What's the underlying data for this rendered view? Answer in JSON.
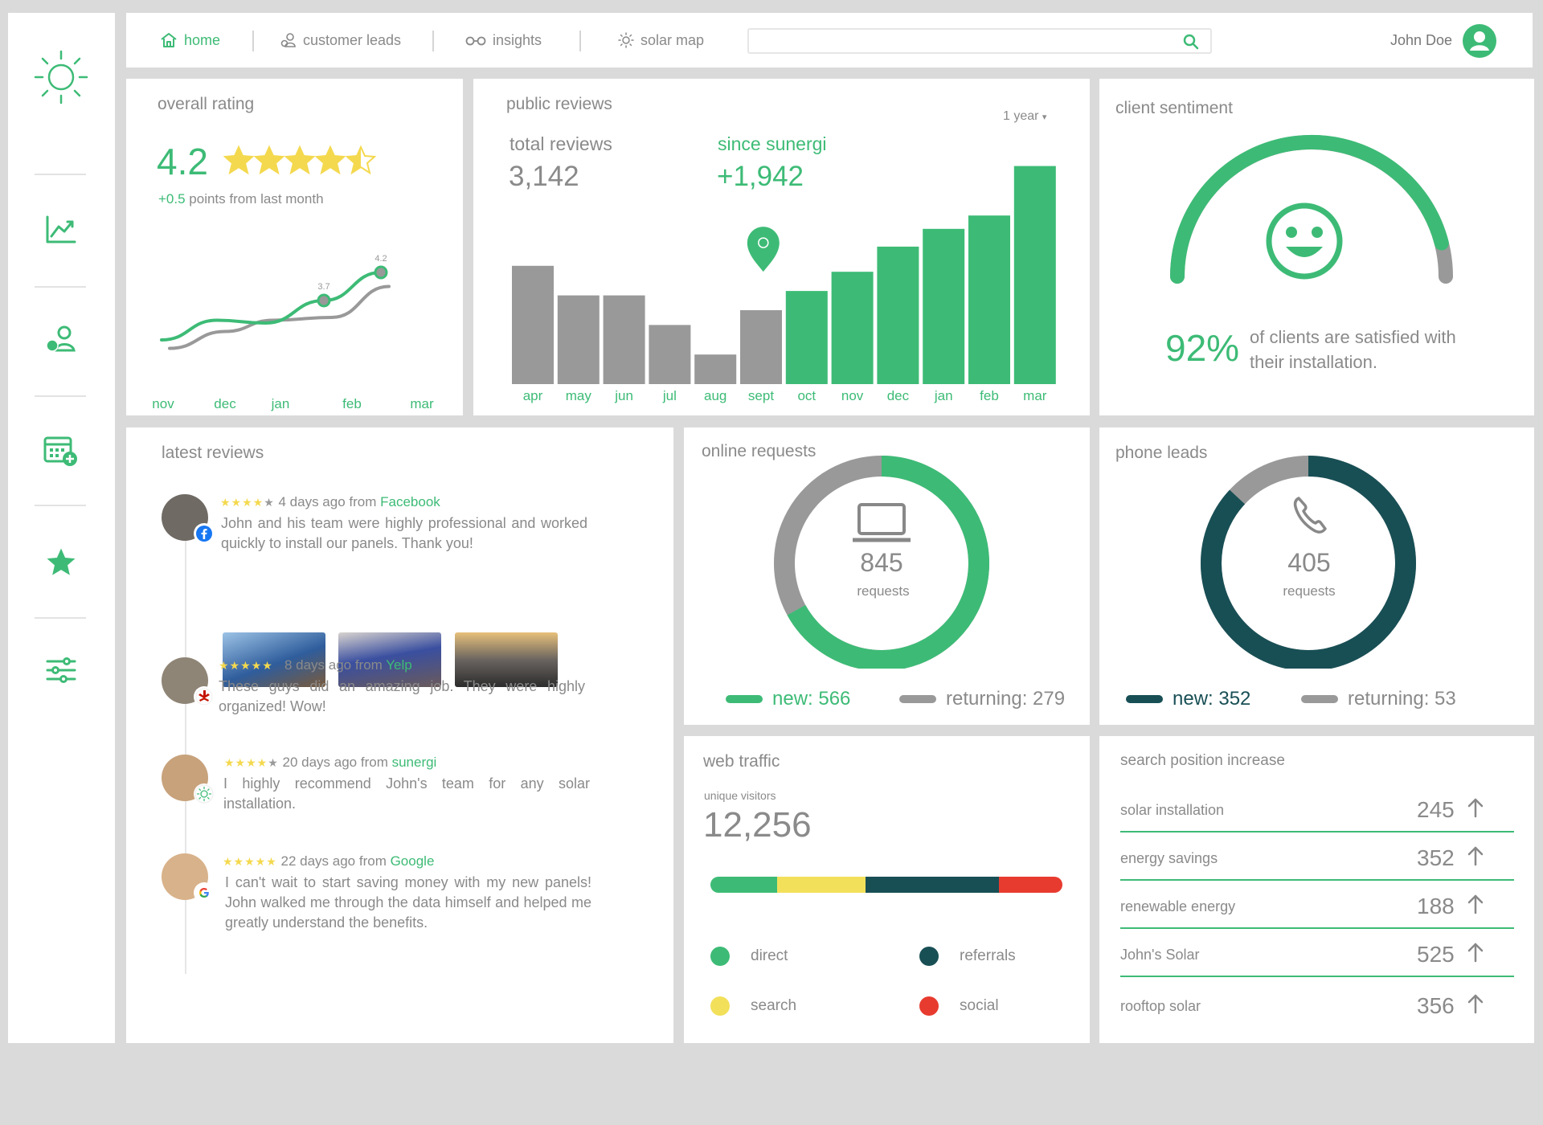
{
  "nav": {
    "home": "home",
    "leads": "customer leads",
    "insights": "insights",
    "solar_map": "solar map",
    "search_placeholder": "",
    "user_name": "John Doe"
  },
  "sidebar": {
    "icons": [
      "sun-logo-icon",
      "chart-icon",
      "user-clock-icon",
      "calendar-add-icon",
      "star-icon",
      "sliders-icon"
    ]
  },
  "rating": {
    "title": "overall rating",
    "value": "4.2",
    "stars": 4.5,
    "change_value": "+0.5",
    "change_text": " points from last month",
    "point_labels": [
      "3.7",
      "4.2"
    ]
  },
  "reviews": {
    "title": "public reviews",
    "period": "1 year",
    "total_label": "total reviews",
    "total_value": "3,142",
    "since_label": "since sunergi",
    "since_value": "+1,942"
  },
  "sentiment": {
    "title": "client sentiment",
    "percent": "92%",
    "text": "of clients are satisfied with their installation.",
    "satisfied_fraction": 0.92
  },
  "latest": {
    "title": "latest reviews",
    "items": [
      {
        "rating": 4,
        "stars_filled": "★★★★",
        "stars_empty": "★",
        "ago": "4 days ago from ",
        "source": "Facebook",
        "text": "John and his team were highly professional and worked quickly to install our panels. Thank you!",
        "source_icon": "facebook-icon"
      },
      {
        "rating": 5,
        "stars_filled": "★★★★★",
        "stars_empty": "",
        "ago": "8 days ago from ",
        "source": "Yelp",
        "text": "These guys did an amazing job. They were highly organized! Wow!",
        "source_icon": "yelp-icon"
      },
      {
        "rating": 4,
        "stars_filled": "★★★★",
        "stars_empty": "★",
        "ago": "20 days ago from ",
        "source": "sunergi",
        "text": "I highly recommend John's team for any solar installation.",
        "source_icon": "sunergi-icon"
      },
      {
        "rating": 5,
        "stars_filled": "★★★★★",
        "stars_empty": "",
        "ago": "22 days ago from ",
        "source": "Google",
        "text": "I can't wait to start saving money with my new panels! John walked me through the data himself and helped me greatly understand the benefits.",
        "source_icon": "google-icon"
      }
    ]
  },
  "online": {
    "title": "online requests",
    "value": "845",
    "unit": "requests",
    "new_label": "new: 566",
    "returning_label": "returning: 279",
    "new": 566,
    "returning": 279
  },
  "phone": {
    "title": "phone leads",
    "value": "405",
    "unit": "requests",
    "new_label": "new: 352",
    "returning_label": "returning: 53",
    "new": 352,
    "returning": 53
  },
  "traffic": {
    "title": "web traffic",
    "visitors_label": "unique visitors",
    "visitors_value": "12,256",
    "segments": [
      {
        "name": "direct",
        "share": 0.19,
        "color": "#3dbb76"
      },
      {
        "name": "search",
        "share": 0.25,
        "color": "#f2e05b"
      },
      {
        "name": "referrals",
        "share": 0.38,
        "color": "#184f55"
      },
      {
        "name": "social",
        "share": 0.18,
        "color": "#e83b2f"
      }
    ],
    "legend": {
      "direct": "direct",
      "search": "search",
      "referrals": "referrals",
      "social": "social"
    }
  },
  "position": {
    "title": "search position increase",
    "rows": [
      {
        "term": "solar installation",
        "value": "245"
      },
      {
        "term": "energy savings",
        "value": "352"
      },
      {
        "term": "renewable energy",
        "value": "188"
      },
      {
        "term": "John's Solar",
        "value": "525"
      },
      {
        "term": "rooftop solar",
        "value": "356"
      }
    ]
  },
  "colors": {
    "green": "#3dbb76",
    "gray": "#999999",
    "dark_teal": "#184f55",
    "yellow": "#f2e05b",
    "red": "#e83b2f"
  },
  "chart_data": [
    {
      "type": "line",
      "x": [
        "nov",
        "dec",
        "jan",
        "feb",
        "mar"
      ],
      "series": [
        {
          "values": [
            3.0,
            3.35,
            3.3,
            3.7,
            4.2
          ],
          "color": "#3dbb76"
        },
        {
          "values": [
            2.85,
            3.15,
            3.35,
            3.4,
            3.95
          ],
          "color": "#999999"
        }
      ],
      "data_labels": [
        "3.7",
        "4.2"
      ],
      "ylim": [
        2.5,
        4.5
      ]
    },
    {
      "type": "bar",
      "categories": [
        "apr",
        "may",
        "jun",
        "jul",
        "aug",
        "sept",
        "oct",
        "nov",
        "dec",
        "jan",
        "feb",
        "mar"
      ],
      "values": [
        160,
        120,
        120,
        80,
        40,
        100,
        126,
        152,
        186,
        210,
        228,
        295
      ],
      "highlight_from": "oct",
      "ylim": [
        0,
        300
      ]
    }
  ]
}
